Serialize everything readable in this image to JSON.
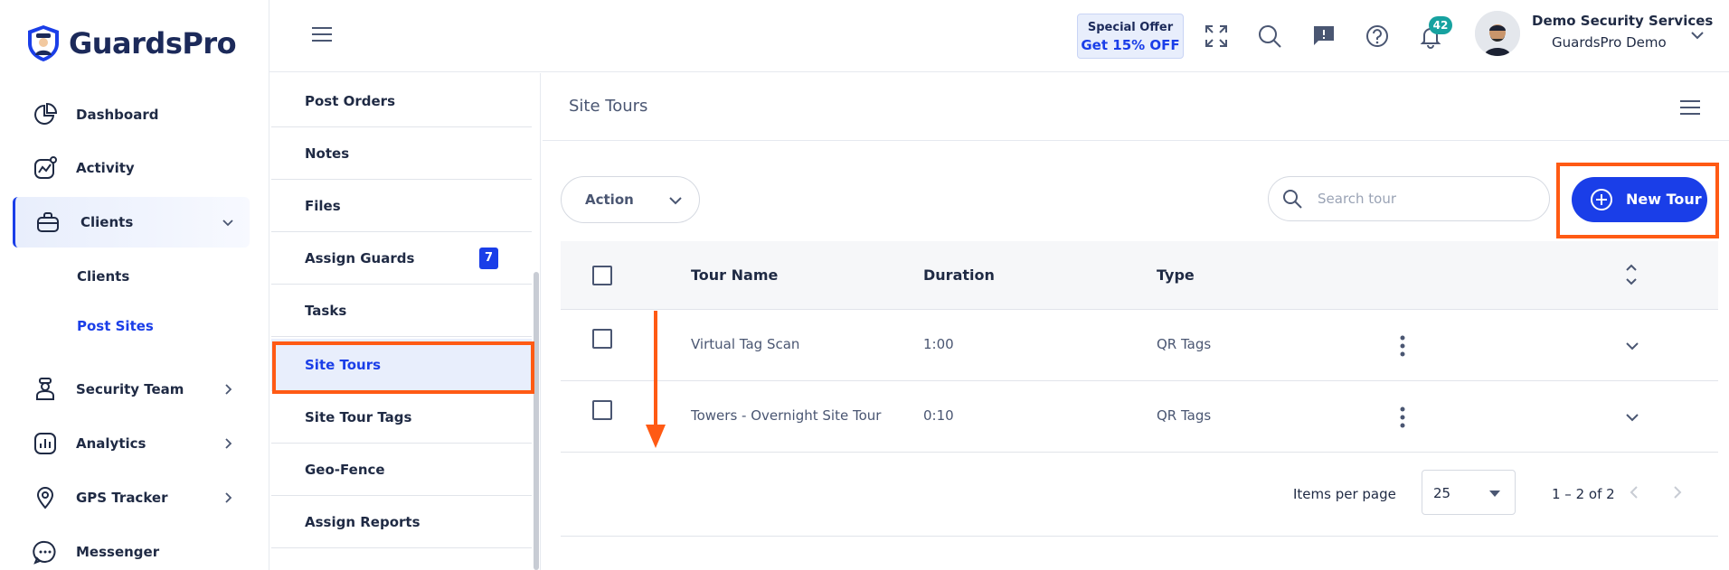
{
  "brand": {
    "name": "GuardsPro",
    "accent": "#1a3ee8",
    "highlight": "#ff5a14"
  },
  "sidebar": {
    "items": [
      {
        "label": "Dashboard",
        "icon": "pie-chart-icon"
      },
      {
        "label": "Activity",
        "icon": "activity-chart-icon"
      },
      {
        "label": "Clients",
        "icon": "briefcase-icon"
      },
      {
        "label": "Security Team",
        "icon": "guard-icon"
      },
      {
        "label": "Analytics",
        "icon": "bar-chart-icon"
      },
      {
        "label": "GPS Tracker",
        "icon": "map-pin-icon"
      },
      {
        "label": "Messenger",
        "icon": "chat-icon"
      }
    ],
    "clients_sub": [
      {
        "label": "Clients"
      },
      {
        "label": "Post Sites"
      }
    ]
  },
  "header": {
    "offer_line1": "Special Offer",
    "offer_line2": "Get 15% OFF",
    "notifications_count": "42",
    "user_name": "Demo Security Services",
    "user_company": "GuardsPro Demo"
  },
  "submenu": {
    "items": [
      {
        "label": "Post Orders"
      },
      {
        "label": "Notes"
      },
      {
        "label": "Files"
      },
      {
        "label": "Assign Guards",
        "badge": "7"
      },
      {
        "label": "Tasks"
      },
      {
        "label": "Site Tours"
      },
      {
        "label": "Site Tour Tags"
      },
      {
        "label": "Geo-Fence"
      },
      {
        "label": "Assign Reports"
      }
    ]
  },
  "main": {
    "title": "Site Tours",
    "action_label": "Action",
    "search_placeholder": "Search tour",
    "new_tour_label": "New Tour",
    "columns": [
      "Tour Name",
      "Duration",
      "Type"
    ],
    "rows": [
      {
        "name": "Virtual Tag Scan",
        "duration": "1:00",
        "type": "QR Tags"
      },
      {
        "name": "Towers - Overnight Site Tour",
        "duration": "0:10",
        "type": "QR Tags"
      }
    ],
    "pagination": {
      "items_per_page_label": "Items per page",
      "items_per_page": "25",
      "range": "1 – 2 of 2"
    }
  }
}
